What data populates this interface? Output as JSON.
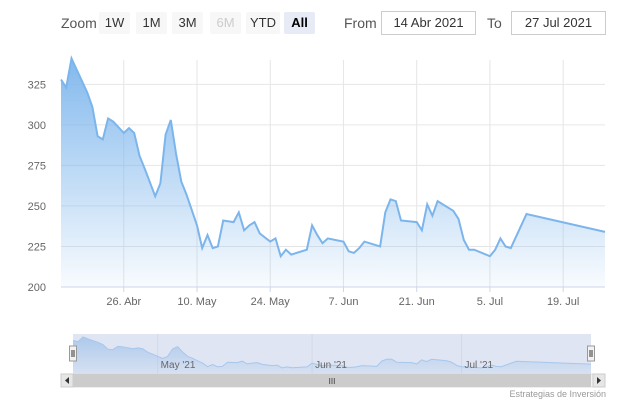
{
  "toolbar": {
    "zoom_label": "Zoom",
    "buttons": [
      {
        "label": "1W",
        "state": "normal"
      },
      {
        "label": "1M",
        "state": "normal"
      },
      {
        "label": "3M",
        "state": "normal"
      },
      {
        "label": "6M",
        "state": "disabled"
      },
      {
        "label": "YTD",
        "state": "normal"
      },
      {
        "label": "All",
        "state": "active"
      }
    ],
    "from_label": "From",
    "from_value": "14 Abr 2021",
    "to_label": "To",
    "to_value": "27 Jul 2021"
  },
  "credits": "Estrategias de Inversión",
  "colors": {
    "line": "#7cb5ec",
    "area_top": "#7cb5ec",
    "grid": "#e6e6e6",
    "navigator_mask": "#ccd6eb"
  },
  "navigator": {
    "labels": [
      "May '21",
      "Jun '21",
      "Jul '21"
    ],
    "scrollbar_grip": "III"
  },
  "chart_data": {
    "type": "area",
    "title": "",
    "xlabel": "",
    "ylabel": "",
    "x_start": "2021-04-14",
    "x_end": "2021-07-27",
    "ylim": [
      200,
      340
    ],
    "yticks": [
      200,
      225,
      250,
      275,
      300,
      325
    ],
    "xticks": [
      {
        "date": "2021-04-26",
        "label": "26. Abr"
      },
      {
        "date": "2021-05-10",
        "label": "10. May"
      },
      {
        "date": "2021-05-24",
        "label": "24. May"
      },
      {
        "date": "2021-06-07",
        "label": "7. Jun"
      },
      {
        "date": "2021-06-21",
        "label": "21. Jun"
      },
      {
        "date": "2021-07-05",
        "label": "5. Jul"
      },
      {
        "date": "2021-07-19",
        "label": "19. Jul"
      }
    ],
    "grid": true,
    "points": [
      [
        "2021-04-14",
        328
      ],
      [
        "2021-04-15",
        323
      ],
      [
        "2021-04-16",
        341
      ],
      [
        "2021-04-17",
        334
      ],
      [
        "2021-04-19",
        320
      ],
      [
        "2021-04-20",
        311
      ],
      [
        "2021-04-21",
        293
      ],
      [
        "2021-04-22",
        291
      ],
      [
        "2021-04-23",
        304
      ],
      [
        "2021-04-24",
        302
      ],
      [
        "2021-04-26",
        295
      ],
      [
        "2021-04-27",
        298
      ],
      [
        "2021-04-28",
        295
      ],
      [
        "2021-04-29",
        281
      ],
      [
        "2021-04-30",
        273
      ],
      [
        "2021-05-02",
        256
      ],
      [
        "2021-05-03",
        264
      ],
      [
        "2021-05-04",
        294
      ],
      [
        "2021-05-05",
        303
      ],
      [
        "2021-05-06",
        282
      ],
      [
        "2021-05-07",
        265
      ],
      [
        "2021-05-08",
        257
      ],
      [
        "2021-05-10",
        238
      ],
      [
        "2021-05-11",
        224
      ],
      [
        "2021-05-12",
        232
      ],
      [
        "2021-05-13",
        224
      ],
      [
        "2021-05-14",
        225
      ],
      [
        "2021-05-15",
        241
      ],
      [
        "2021-05-17",
        240
      ],
      [
        "2021-05-18",
        246
      ],
      [
        "2021-05-19",
        235
      ],
      [
        "2021-05-20",
        238
      ],
      [
        "2021-05-21",
        240
      ],
      [
        "2021-05-22",
        233
      ],
      [
        "2021-05-24",
        228
      ],
      [
        "2021-05-25",
        230
      ],
      [
        "2021-05-26",
        219
      ],
      [
        "2021-05-27",
        223
      ],
      [
        "2021-05-28",
        220
      ],
      [
        "2021-05-31",
        223
      ],
      [
        "2021-06-01",
        238
      ],
      [
        "2021-06-02",
        232
      ],
      [
        "2021-06-03",
        227
      ],
      [
        "2021-06-04",
        230
      ],
      [
        "2021-06-07",
        228
      ],
      [
        "2021-06-08",
        222
      ],
      [
        "2021-06-09",
        221
      ],
      [
        "2021-06-10",
        224
      ],
      [
        "2021-06-11",
        228
      ],
      [
        "2021-06-14",
        225
      ],
      [
        "2021-06-15",
        246
      ],
      [
        "2021-06-16",
        254
      ],
      [
        "2021-06-17",
        253
      ],
      [
        "2021-06-18",
        241
      ],
      [
        "2021-06-21",
        240
      ],
      [
        "2021-06-22",
        235
      ],
      [
        "2021-06-23",
        251
      ],
      [
        "2021-06-24",
        244
      ],
      [
        "2021-06-25",
        253
      ],
      [
        "2021-06-28",
        247
      ],
      [
        "2021-06-29",
        242
      ],
      [
        "2021-06-30",
        229
      ],
      [
        "2021-07-01",
        223
      ],
      [
        "2021-07-02",
        223
      ],
      [
        "2021-07-05",
        219
      ],
      [
        "2021-07-06",
        223
      ],
      [
        "2021-07-07",
        230
      ],
      [
        "2021-07-08",
        225
      ],
      [
        "2021-07-09",
        224
      ],
      [
        "2021-07-12",
        245
      ],
      [
        "2021-07-27",
        234
      ]
    ]
  }
}
